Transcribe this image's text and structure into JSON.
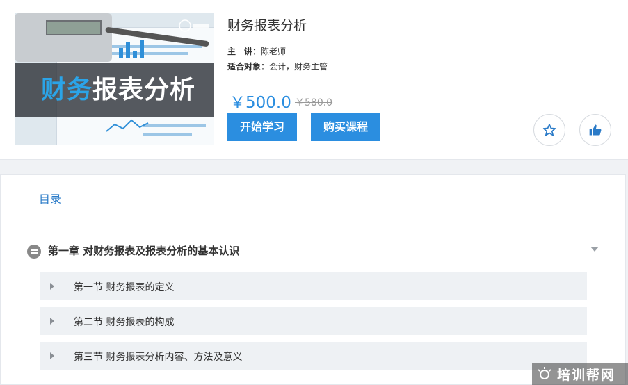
{
  "course": {
    "title": "财务报表分析",
    "cover_text_highlight": "财务",
    "cover_text_rest": "报表分析",
    "instructor_label": "主　讲：",
    "instructor": "陈老师",
    "audience_label": "适合对象：",
    "audience": "会计，财务主管",
    "price": "￥500.0",
    "original_price": "￥580.0",
    "start_button": "开始学习",
    "buy_button": "购买课程",
    "favorite_icon": "star-icon",
    "like_icon": "thumbs-up-icon"
  },
  "catalog": {
    "tab_label": "目录",
    "chapter": {
      "title": "第一章 对财务报表及报表分析的基本认识",
      "icon": "collapse-icon"
    },
    "sections": [
      {
        "label": "第一节 财务报表的定义"
      },
      {
        "label": "第二节 财务报表的构成"
      },
      {
        "label": "第三节 财务报表分析内容、方法及意义"
      }
    ]
  },
  "watermark": {
    "text": "培训帮网"
  },
  "colors": {
    "accent": "#2b8ee0",
    "tab_text": "#2b7bc8",
    "section_bg": "#eef1f4"
  }
}
